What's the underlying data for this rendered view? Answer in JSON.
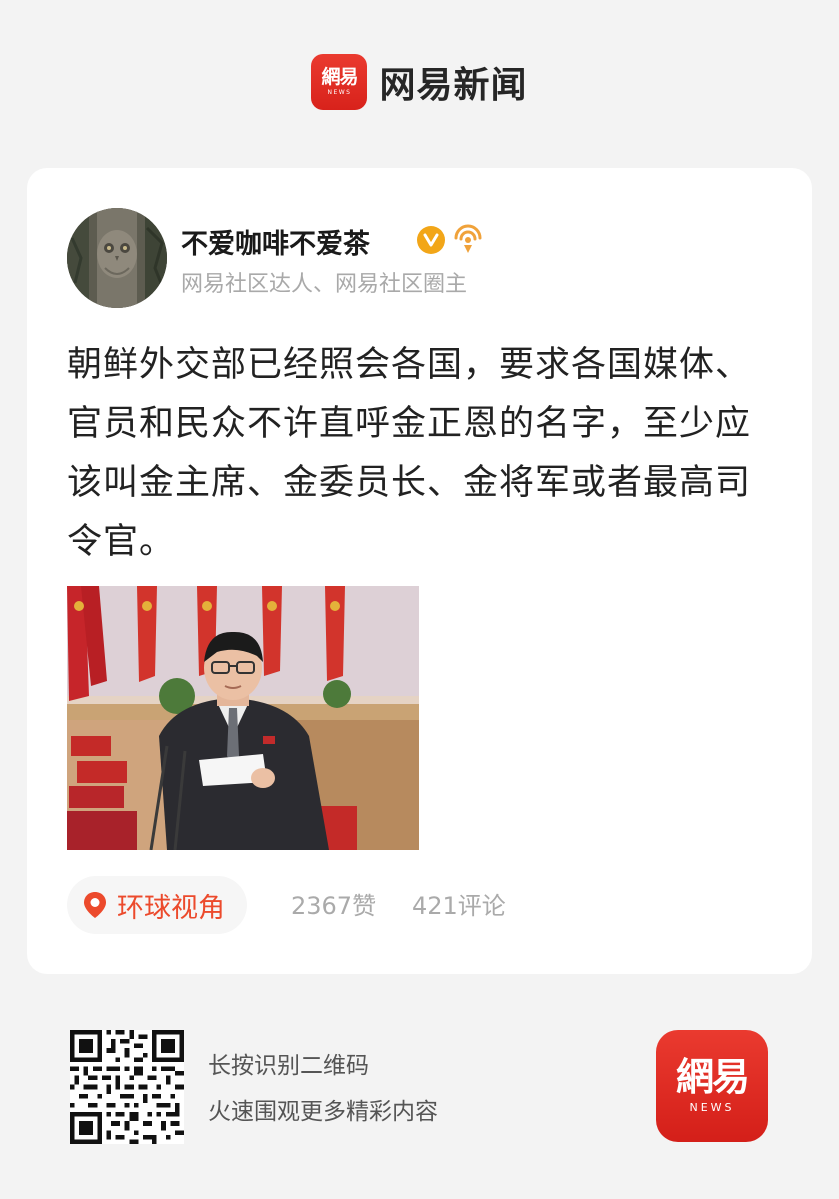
{
  "header": {
    "logo_cn": "網易",
    "logo_en": "NEWS",
    "app_name": "网易新闻"
  },
  "post": {
    "author": "不爱咖啡不爱茶",
    "author_desc": "网易社区达人、网易社区圈主",
    "verified_icon": "verified-v-icon",
    "text": "朝鲜外交部已经照会各国，要求各国媒体、官员和民众不许直呼金正恩的名字，至少应该叫金主席、金委员长、金将军或者最高司令官。",
    "topic": "环球视角",
    "likes": "2367赞",
    "comments": "421评论"
  },
  "footer": {
    "line1": "长按识别二维码",
    "line2": "火速围观更多精彩内容",
    "logo_cn": "網易",
    "logo_en": "NEWS"
  },
  "colors": {
    "brand_red": "#e0271f",
    "topic_orange": "#ec4a2c",
    "verified_gold": "#f2a618",
    "background": "#f3f3f3"
  }
}
